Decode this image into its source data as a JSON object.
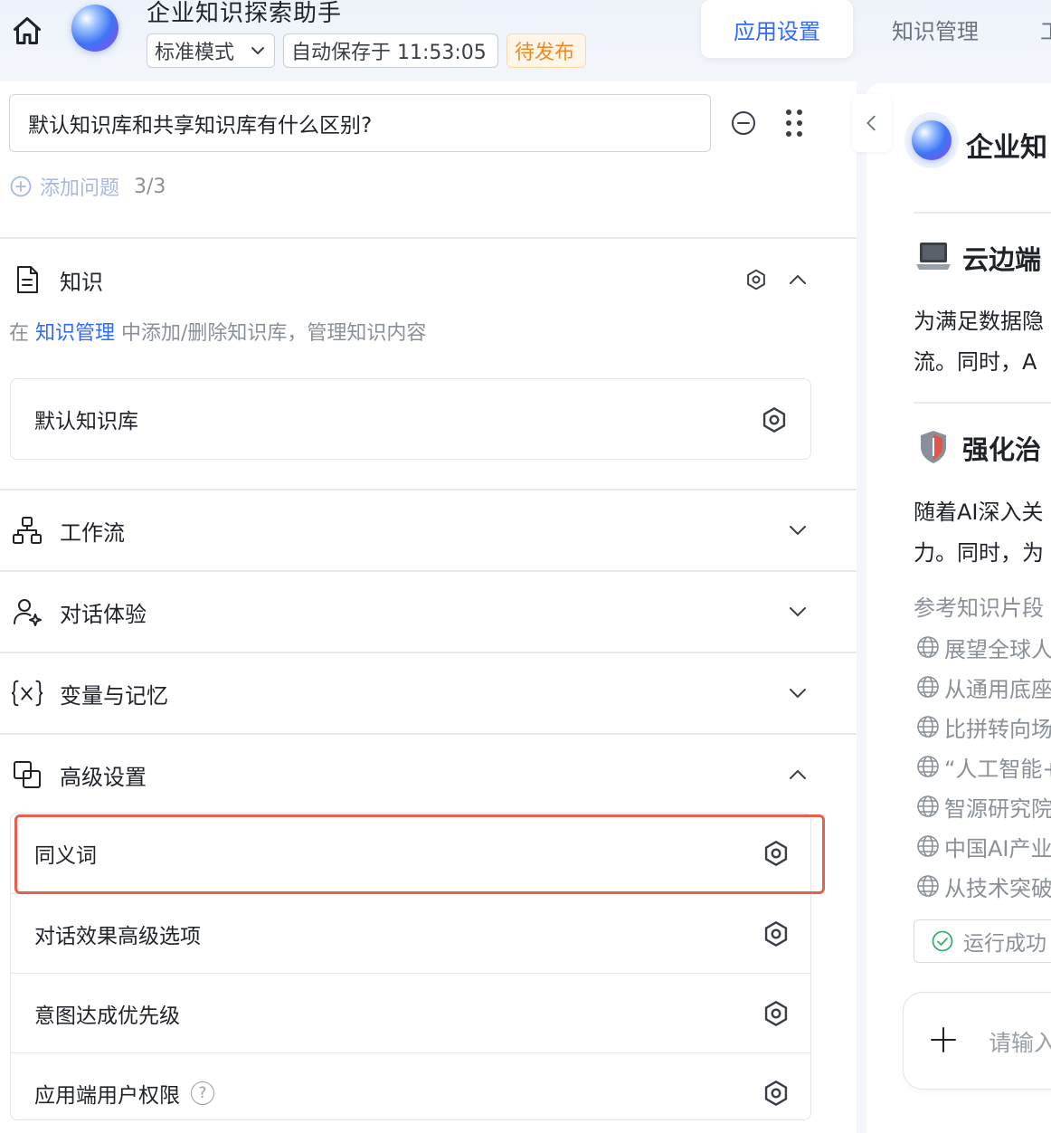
{
  "header": {
    "app_title": "企业知识探索助手",
    "mode_label": "标准模式",
    "autosave_text": "自动保存于 11:53:05",
    "status_badge": "待发布",
    "tabs": [
      {
        "label": "应用设置",
        "active": true
      },
      {
        "label": "知识管理",
        "active": false
      },
      {
        "label": "工",
        "active": false
      }
    ]
  },
  "questions": {
    "items": [
      {
        "text": "默认知识库和共享知识库有什么区别?"
      }
    ],
    "add_label": "添加问题",
    "count": "3/3"
  },
  "sections": {
    "knowledge": {
      "title": "知识",
      "desc_prefix": "在 ",
      "desc_link": "知识管理",
      "desc_suffix": " 中添加/删除知识库，管理知识内容",
      "kb_items": [
        {
          "name": "默认知识库"
        }
      ]
    },
    "workflow": {
      "title": "工作流"
    },
    "conversation": {
      "title": "对话体验"
    },
    "variables": {
      "title": "变量与记忆"
    },
    "advanced": {
      "title": "高级设置",
      "items": [
        {
          "label": "同义词",
          "highlighted": true
        },
        {
          "label": "对话效果高级选项"
        },
        {
          "label": "意图达成优先级"
        },
        {
          "label": "应用端用户权限",
          "help_icon": "?"
        }
      ]
    }
  },
  "preview": {
    "bot_name": "企业知",
    "sections": [
      {
        "icon": "laptop-icon",
        "heading": "云边端",
        "lines": [
          "为满足数据隐",
          "流。同时，A"
        ]
      },
      {
        "icon": "shield-icon",
        "heading": "强化治",
        "lines": [
          "随着AI深入关",
          "力。同时，为"
        ]
      }
    ],
    "refs_title": "参考知识片段",
    "refs": [
      "展望全球人",
      "从通用底座",
      "比拼转向场",
      "“人工智能+",
      "智源研究院",
      "中国AI产业",
      "从技术突破"
    ],
    "status_text": "运行成功",
    "input_placeholder": "请输入"
  },
  "colors": {
    "accent": "#2f6bff",
    "status_badge": "#f08a24",
    "highlight_border": "#e8604c",
    "success": "#35b36b"
  }
}
